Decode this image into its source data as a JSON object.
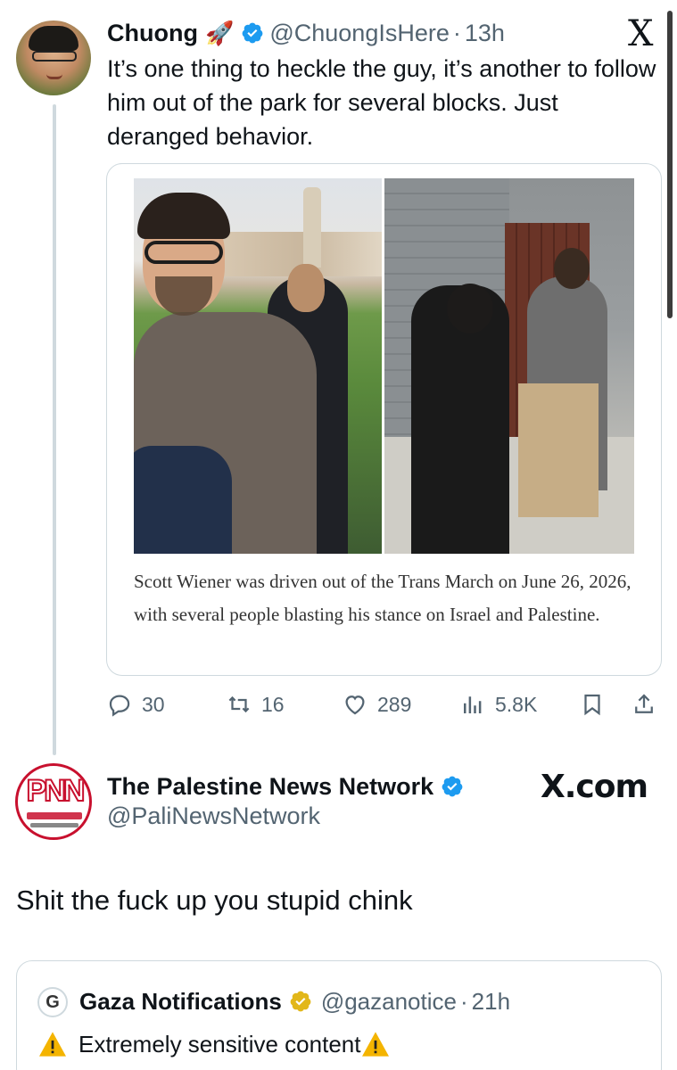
{
  "tweet1": {
    "name": "Chuong",
    "name_emoji": "🚀",
    "handle": "@ChuongIsHere",
    "separator": "·",
    "time": "13h",
    "x_logo": "X",
    "text": "It’s one thing to heckle the guy, it’s another to follow him out of the park for several blocks. Just deranged behavior.",
    "card_caption": "Scott Wiener was driven out of the Trans March on June 26, 2026, with several people blasting his stance on Israel and Palestine.",
    "actions": {
      "replies": "30",
      "reposts": "16",
      "likes": "289",
      "views": "5.8K"
    },
    "verified_color": "#1d9bf0"
  },
  "tweet2": {
    "avatar_text": "PNN",
    "name": "The Palestine News Network",
    "handle": "@PaliNewsNetwork",
    "watermark": "X.com",
    "text": "Shit the fuck up you stupid chink",
    "logo_color": "#c8102e"
  },
  "quote": {
    "avatar_letter": "G",
    "name": "Gaza Notifications",
    "handle": "@gazanotice",
    "separator": "·",
    "time": "21h",
    "warning_text": "Extremely sensitive content",
    "badge_color": "#e2b719"
  },
  "icons": [
    "verified-icon",
    "reply-icon",
    "repost-icon",
    "like-icon",
    "views-icon",
    "bookmark-icon",
    "share-icon",
    "warning-icon"
  ]
}
